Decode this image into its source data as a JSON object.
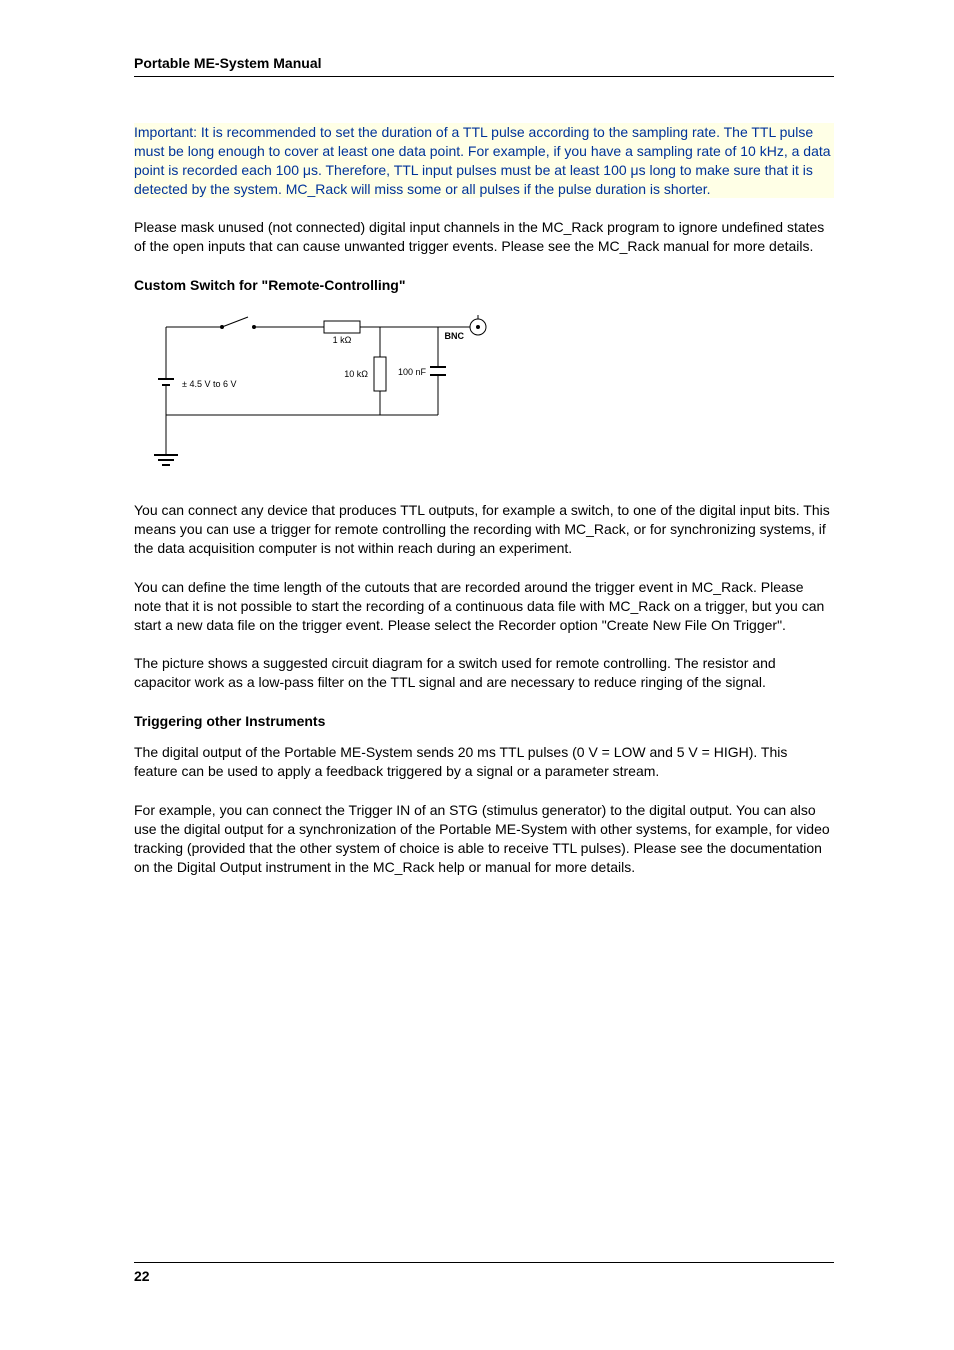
{
  "header": {
    "title": "Portable ME-System Manual"
  },
  "important_note": "Important: It is recommended to set the duration of a TTL pulse according to the sampling rate. The TTL pulse must be long enough to cover at least one data point. For example, if you have a sampling rate of 10 kHz, a data point is recorded each 100 μs. Therefore, TTL input pulses must be at least 100 μs long to make sure that it is detected by the system. MC_Rack will miss some or all pulses if the pulse duration is shorter.",
  "mask_note": "Please mask unused (not connected) digital input channels in the MC_Rack program to ignore undefined states of the open inputs that can cause unwanted trigger events. Please see the MC_Rack manual for more details.",
  "section_custom": {
    "heading": "Custom Switch for \"Remote-Controlling\"",
    "circuit": {
      "voltage": "± 4.5 V to 6 V",
      "r1": "1 kΩ",
      "r2": "10 kΩ",
      "c1": "100 nF",
      "connector": "BNC"
    },
    "p1": "You can connect any device that produces TTL outputs, for example a switch, to one of the digital input bits. This means you can use a trigger for remote controlling the recording with MC_Rack, or for synchronizing systems, if the data acquisition computer is not within reach during an experiment.",
    "p2": "You can define the time length of the cutouts that are recorded around the trigger event in MC_Rack. Please note that it is not possible to start the recording of a continuous data file with MC_Rack on a trigger, but you can start a new data file on the trigger event. Please select the Recorder option \"Create New File On Trigger\".",
    "p3": "The picture shows a suggested circuit diagram for a switch used for remote controlling. The resistor and capacitor work as a low-pass filter on the TTL signal and are necessary to reduce ringing of the signal."
  },
  "section_trigger": {
    "heading": "Triggering other Instruments",
    "p1": "The digital output of the Portable ME-System sends 20 ms TTL pulses (0 V = LOW and 5 V = HIGH). This feature can be used to apply a feedback triggered by a signal or a parameter stream.",
    "p2": "For example, you can connect the Trigger IN of an STG (stimulus generator) to the digital output. You can also use the digital output for a synchronization of the Portable ME-System with other systems, for example, for video tracking (provided that the other system of choice is able to receive TTL pulses). Please see the documentation on the Digital Output instrument in the MC_Rack help or manual for more details."
  },
  "footer": {
    "page_number": "22"
  }
}
